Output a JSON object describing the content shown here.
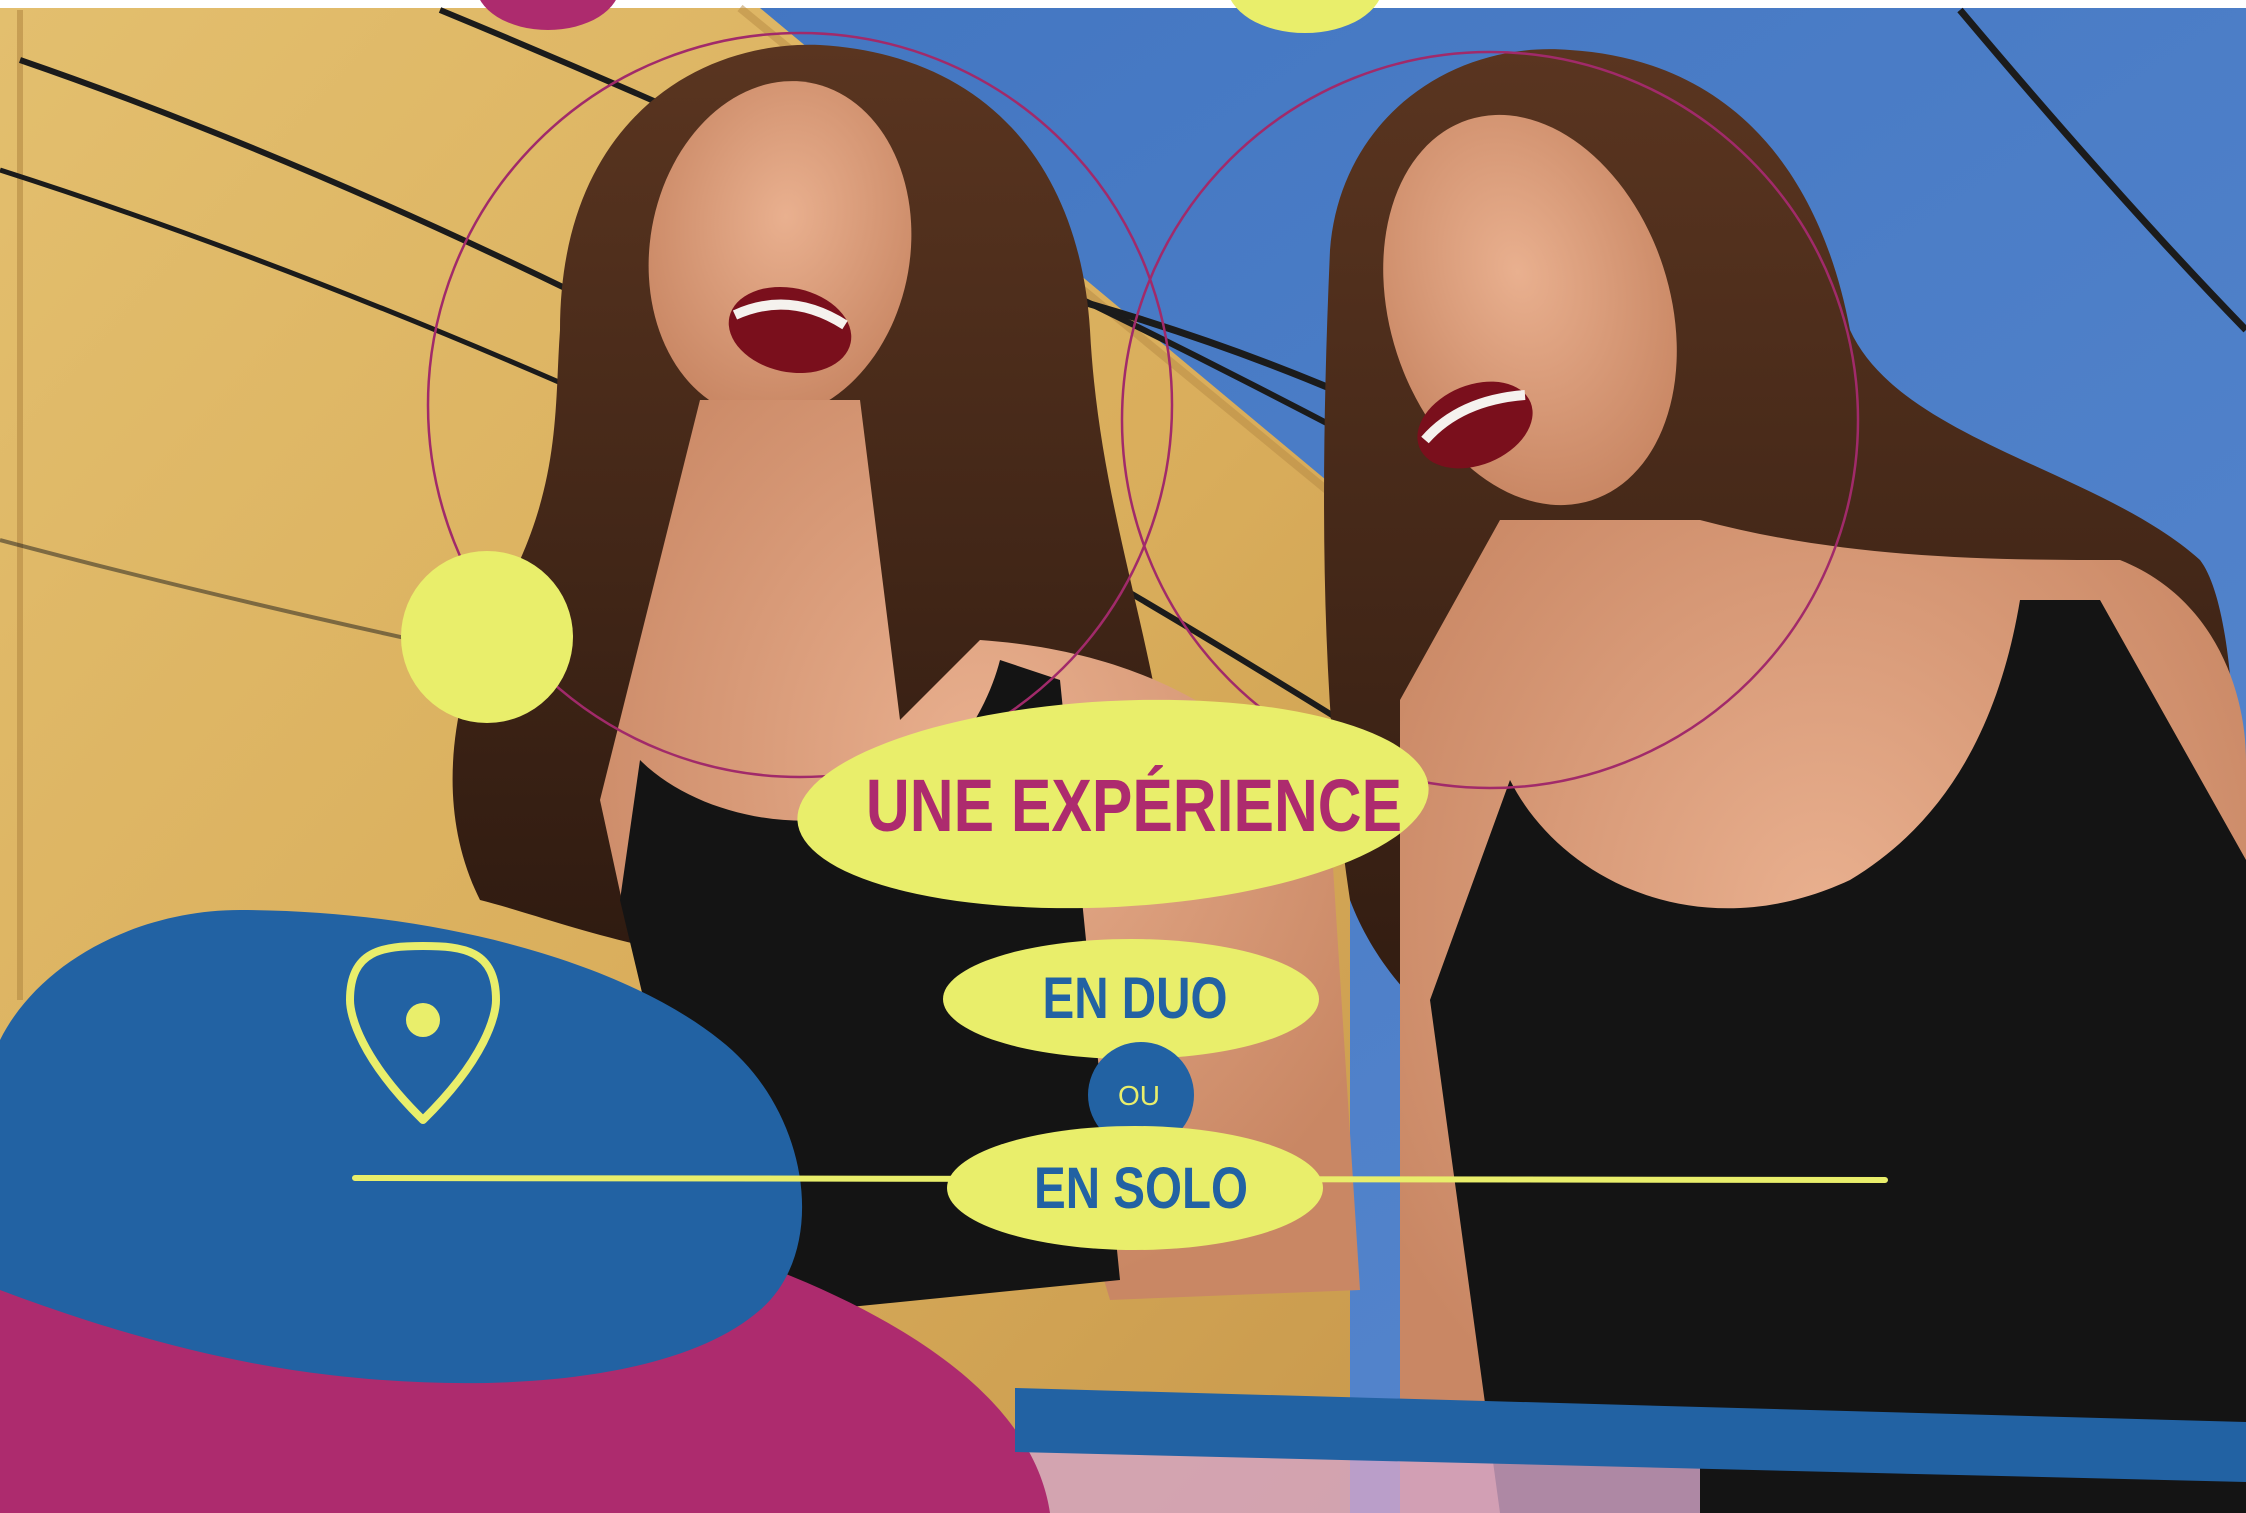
{
  "headline": "UNE EXPÉRIENCE",
  "options": {
    "first": "EN DUO",
    "connector": "OU",
    "second": "EN SOLO"
  },
  "icons": {
    "location": "location-pin-icon"
  },
  "colors": {
    "brand_blue": "#2262a3",
    "brand_magenta": "#ad2b6e",
    "accent_yellow": "#e9ee6b",
    "sky_blue": "#4a7ac3",
    "wall_yellow": "#e0b664"
  }
}
